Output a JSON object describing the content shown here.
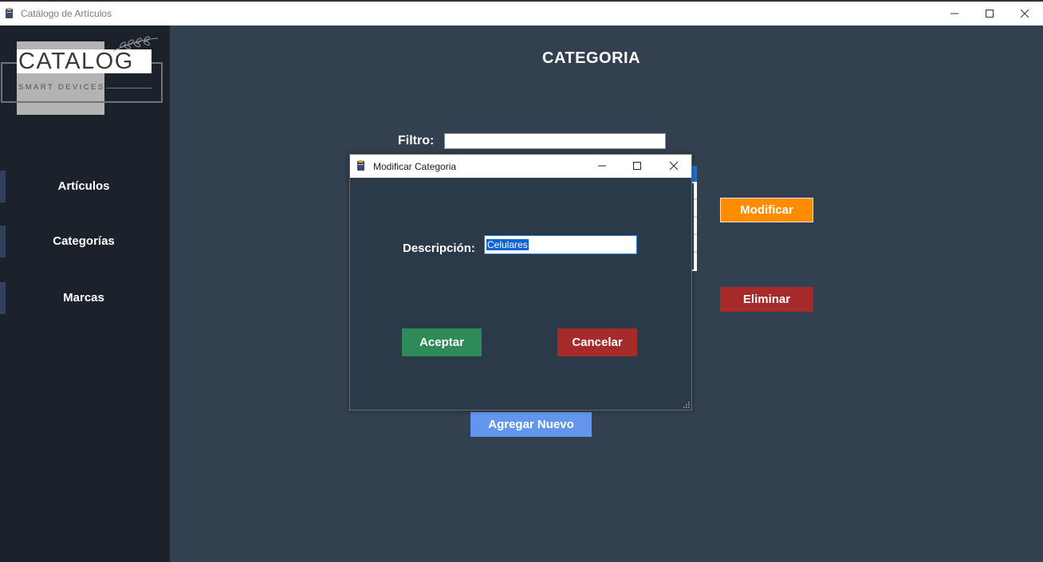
{
  "window": {
    "title": "Catálogo de Artículos"
  },
  "logo": {
    "text": "CATALOG",
    "subtitle": "SMART DEVICES"
  },
  "sidebar": {
    "items": [
      {
        "label": "Artículos"
      },
      {
        "label": "Categorías"
      },
      {
        "label": "Marcas"
      }
    ]
  },
  "main": {
    "title": "CATEGORIA",
    "filter_label": "Filtro:",
    "filter_value": "",
    "modify_label": "Modificar",
    "delete_label": "Eliminar",
    "add_label": "Agregar Nuevo"
  },
  "dialog": {
    "title": "Modificar Categoria",
    "description_label": "Descripción:",
    "description_value": "Celulares",
    "accept_label": "Aceptar",
    "cancel_label": "Cancelar"
  },
  "colors": {
    "sidebar": "#1c222b",
    "main": "#33404f",
    "dialog": "#2b3a49",
    "modify": "#ff8c00",
    "delete": "#a62a2a",
    "add": "#6495ed",
    "accept": "#2e8b57"
  }
}
